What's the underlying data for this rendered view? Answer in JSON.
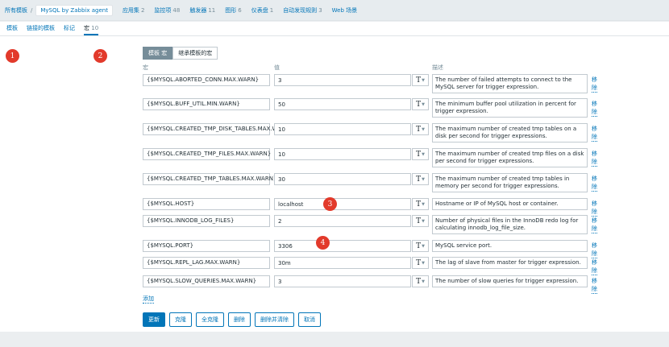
{
  "breadcrumb": {
    "all_templates": "所有模板",
    "separator": "/",
    "current": "MySQL by Zabbix agent"
  },
  "topnav": [
    {
      "label": "应用集",
      "count": "2"
    },
    {
      "label": "监控项",
      "count": "48"
    },
    {
      "label": "触发器",
      "count": "11"
    },
    {
      "label": "图形",
      "count": "6"
    },
    {
      "label": "仪表盘",
      "count": "1"
    },
    {
      "label": "自动发现规则",
      "count": "3"
    },
    {
      "label": "Web 场景",
      "count": ""
    }
  ],
  "tabs": [
    {
      "label": "模板",
      "count": ""
    },
    {
      "label": "链接的模板",
      "count": ""
    },
    {
      "label": "标记",
      "count": ""
    },
    {
      "label": "宏",
      "count": "10"
    }
  ],
  "annotations": [
    "1",
    "2",
    "3",
    "4"
  ],
  "subtabs": {
    "template_macros": "模板 宏",
    "inherited_macros": "继承模板的宏"
  },
  "columns": {
    "macro": "宏",
    "value": "值",
    "description": "描述"
  },
  "macros": [
    {
      "macro": "{$MYSQL.ABORTED_CONN.MAX.WARN}",
      "value": "3",
      "description": "The number of failed attempts to connect to the MySQL server for trigger expression."
    },
    {
      "macro": "{$MYSQL.BUFF_UTIL.MIN.WARN}",
      "value": "50",
      "description": "The minimum buffer pool utilization in percent for trigger expression."
    },
    {
      "macro": "{$MYSQL.CREATED_TMP_DISK_TABLES.MAX.WARN}",
      "value": "10",
      "description": "The maximum number of created tmp tables on a disk per second for trigger expressions."
    },
    {
      "macro": "{$MYSQL.CREATED_TMP_FILES.MAX.WARN}",
      "value": "10",
      "description": "The maximum number of created tmp files on a disk per second for trigger expressions."
    },
    {
      "macro": "{$MYSQL.CREATED_TMP_TABLES.MAX.WARN}",
      "value": "30",
      "description": "The maximum number of created tmp tables in memory per second for trigger expressions."
    },
    {
      "macro": "{$MYSQL.HOST}",
      "value": "localhost",
      "description": "Hostname or IP of MySQL host or container."
    },
    {
      "macro": "{$MYSQL.INNODB_LOG_FILES}",
      "value": "2",
      "description": "Number of physical files in the InnoDB redo log for calculating innodb_log_file_size."
    },
    {
      "macro": "{$MYSQL.PORT}",
      "value": "3306",
      "description": "MySQL service port."
    },
    {
      "macro": "{$MYSQL.REPL_LAG.MAX.WARN}",
      "value": "30m",
      "description": "The lag of slave from master for trigger expression."
    },
    {
      "macro": "{$MYSQL.SLOW_QUERIES.MAX.WARN}",
      "value": "3",
      "description": "The number of slow queries for trigger expression."
    }
  ],
  "type_icon": "T",
  "remove_label": "移除",
  "add_label": "添加",
  "buttons": {
    "update": "更新",
    "clone": "克隆",
    "full_clone": "全克隆",
    "delete": "删除",
    "delete_and_clear": "删除并清除",
    "cancel": "取消"
  },
  "colors": {
    "accent": "#0275b8",
    "badge": "#e23a2b"
  }
}
